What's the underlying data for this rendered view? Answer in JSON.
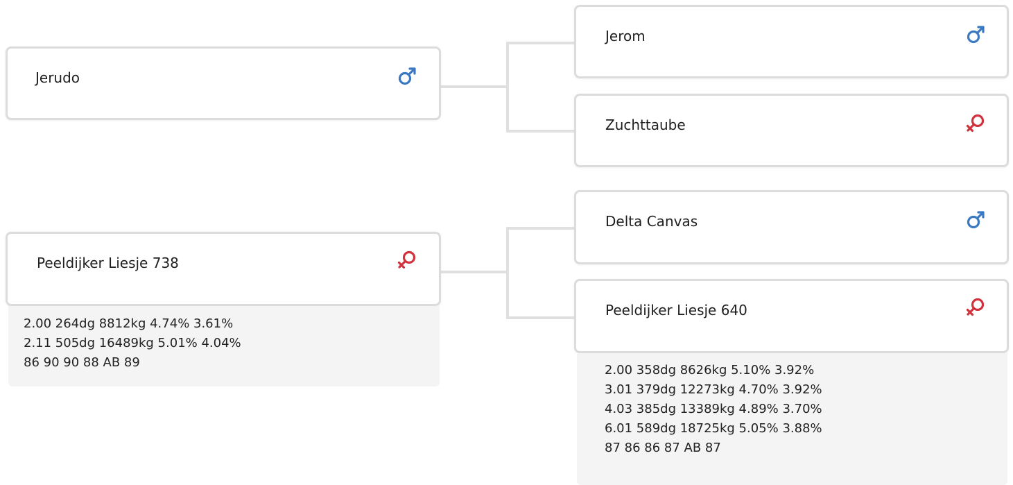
{
  "colors": {
    "male": "#3a78c2",
    "female": "#d0313c",
    "border": "#dcdcdc",
    "info_bg": "#f4f4f4"
  },
  "pedigree": {
    "sire": {
      "name": "Jerudo",
      "sex_icon": "male-symbol-icon",
      "sire": {
        "name": "Jerom",
        "sex_icon": "male-symbol-icon"
      },
      "dam": {
        "name": "Zuchttaube",
        "sex_icon": "female-symbol-icon"
      }
    },
    "dam": {
      "name": "Peeldijker Liesje 738",
      "sex_icon": "female-symbol-icon",
      "info": [
        "2.00 264dg 8812kg 4.74% 3.61%",
        "2.11 505dg 16489kg 5.01% 4.04%",
        "86 90 90 88 AB 89"
      ],
      "sire": {
        "name": "Delta Canvas",
        "sex_icon": "male-symbol-icon"
      },
      "dam": {
        "name": "Peeldijker Liesje 640",
        "sex_icon": "female-symbol-icon",
        "info": [
          "2.00 358dg 8626kg 5.10% 3.92%",
          "3.01 379dg 12273kg 4.70% 3.92%",
          "4.03 385dg 13389kg 4.89% 3.70%",
          "6.01 589dg 18725kg 5.05% 3.88%",
          "87 86 86 87 AB 87"
        ]
      }
    }
  }
}
